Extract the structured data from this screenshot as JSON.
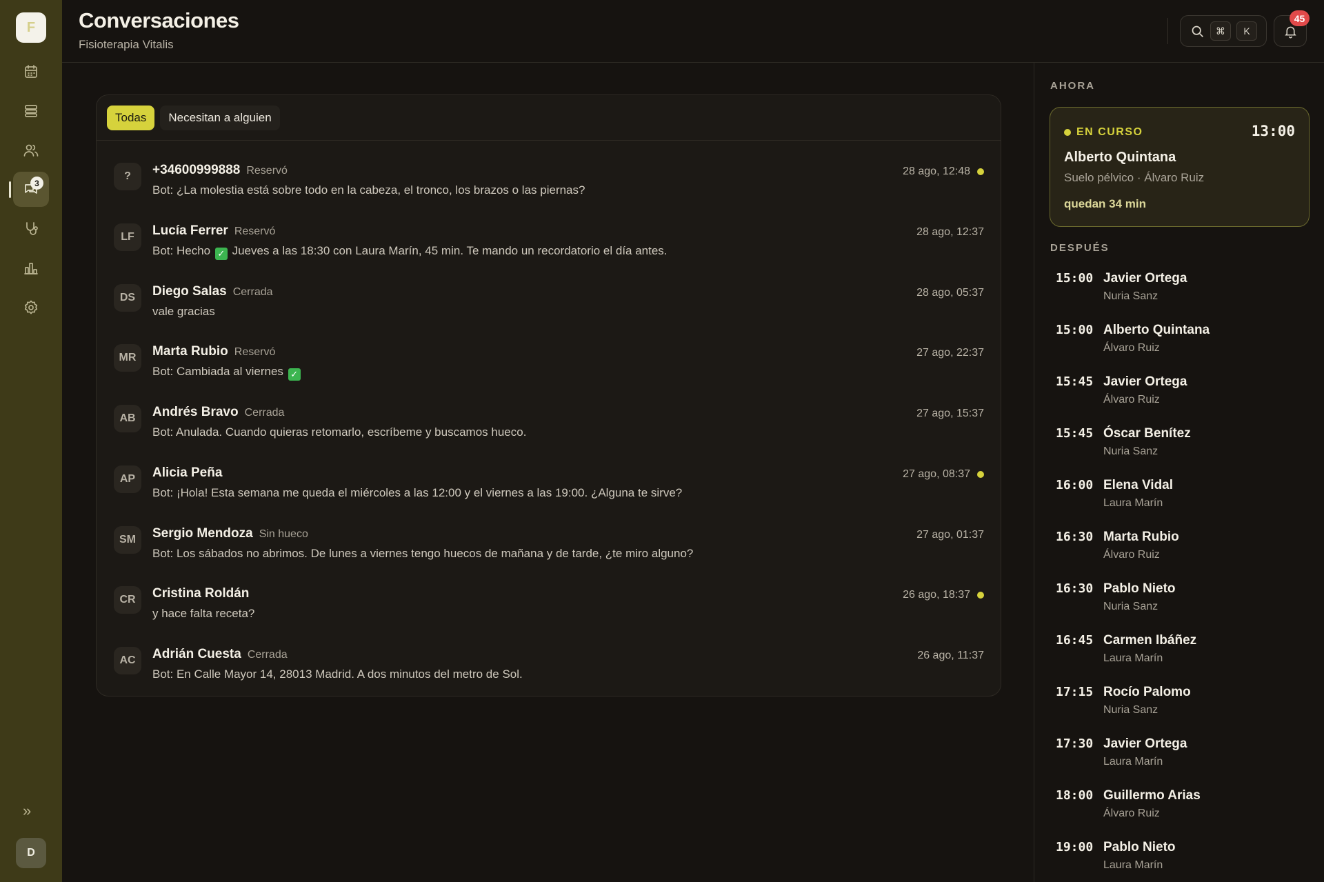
{
  "sidebar": {
    "logo_letter": "F",
    "nav": [
      {
        "name": "calendar-icon",
        "badge": null
      },
      {
        "name": "stack-icon",
        "badge": null
      },
      {
        "name": "users-icon",
        "badge": null
      },
      {
        "name": "chat-icon",
        "badge": "3",
        "active": true
      },
      {
        "name": "stethoscope-icon",
        "badge": null
      },
      {
        "name": "bar-chart-icon",
        "badge": null
      },
      {
        "name": "gear-icon",
        "badge": null
      }
    ],
    "expand_glyph": "»",
    "user_initial": "D"
  },
  "header": {
    "title": "Conversaciones",
    "subtitle": "Fisioterapia Vitalis",
    "shortcut_keys": [
      "⌘",
      "K"
    ],
    "notification_count": "45"
  },
  "tabs": [
    {
      "label": "Todas",
      "active": true
    },
    {
      "label": "Necesitan a alguien",
      "active": false
    }
  ],
  "conversations": [
    {
      "initials": "?",
      "name": "+34600999888",
      "status": "Reservó",
      "time": "28 ago, 12:48",
      "unread": true,
      "message": "Bot: ¿La molestia está sobre todo en la cabeza, el tronco, los brazos o las piernas?"
    },
    {
      "initials": "LF",
      "name": "Lucía Ferrer",
      "status": "Reservó",
      "time": "28 ago, 12:37",
      "unread": false,
      "message_before": "Bot: Hecho",
      "message_after": "Jueves a las 18:30 con Laura Marín, 45 min. Te mando un recordatorio el día antes."
    },
    {
      "initials": "DS",
      "name": "Diego Salas",
      "status": "Cerrada",
      "time": "28 ago, 05:37",
      "unread": false,
      "message": "vale gracias"
    },
    {
      "initials": "MR",
      "name": "Marta Rubio",
      "status": "Reservó",
      "time": "27 ago, 22:37",
      "unread": false,
      "message_before": "Bot: Cambiada al viernes",
      "message_after": ""
    },
    {
      "initials": "AB",
      "name": "Andrés Bravo",
      "status": "Cerrada",
      "time": "27 ago, 15:37",
      "unread": false,
      "message": "Bot: Anulada. Cuando quieras retomarlo, escríbeme y buscamos hueco."
    },
    {
      "initials": "AP",
      "name": "Alicia Peña",
      "status": "",
      "time": "27 ago, 08:37",
      "unread": true,
      "message": "Bot: ¡Hola! Esta semana me queda el miércoles a las 12:00 y el viernes a las 19:00. ¿Alguna te sirve?"
    },
    {
      "initials": "SM",
      "name": "Sergio Mendoza",
      "status": "Sin hueco",
      "time": "27 ago, 01:37",
      "unread": false,
      "message": "Bot: Los sábados no abrimos. De lunes a viernes tengo huecos de mañana y de tarde, ¿te miro alguno?"
    },
    {
      "initials": "CR",
      "name": "Cristina Roldán",
      "status": "",
      "time": "26 ago, 18:37",
      "unread": true,
      "message": "y hace falta receta?"
    },
    {
      "initials": "AC",
      "name": "Adrián Cuesta",
      "status": "Cerrada",
      "time": "26 ago, 11:37",
      "unread": false,
      "message": "Bot: En Calle Mayor 14, 28013 Madrid. A dos minutos del metro de Sol."
    }
  ],
  "now": {
    "section_label": "AHORA",
    "status": "EN CURSO",
    "time": "13:00",
    "patient": "Alberto Quintana",
    "detail": "Suelo pélvico · Álvaro Ruiz",
    "remaining": "quedan 34 min"
  },
  "later": {
    "section_label": "DESPUÉS",
    "items": [
      {
        "time": "15:00",
        "patient": "Javier Ortega",
        "therapist": "Nuria Sanz"
      },
      {
        "time": "15:00",
        "patient": "Alberto Quintana",
        "therapist": "Álvaro Ruiz"
      },
      {
        "time": "15:45",
        "patient": "Javier Ortega",
        "therapist": "Álvaro Ruiz"
      },
      {
        "time": "15:45",
        "patient": "Óscar Benítez",
        "therapist": "Nuria Sanz"
      },
      {
        "time": "16:00",
        "patient": "Elena Vidal",
        "therapist": "Laura Marín"
      },
      {
        "time": "16:30",
        "patient": "Marta Rubio",
        "therapist": "Álvaro Ruiz"
      },
      {
        "time": "16:30",
        "patient": "Pablo Nieto",
        "therapist": "Nuria Sanz"
      },
      {
        "time": "16:45",
        "patient": "Carmen Ibáñez",
        "therapist": "Laura Marín"
      },
      {
        "time": "17:15",
        "patient": "Rocío Palomo",
        "therapist": "Nuria Sanz"
      },
      {
        "time": "17:30",
        "patient": "Javier Ortega",
        "therapist": "Laura Marín"
      },
      {
        "time": "18:00",
        "patient": "Guillermo Arias",
        "therapist": "Álvaro Ruiz"
      },
      {
        "time": "19:00",
        "patient": "Pablo Nieto",
        "therapist": "Laura Marín"
      }
    ]
  },
  "colors": {
    "accent": "#d6d23c",
    "sidebar": "#3e3a18",
    "background": "#161310",
    "badge_red": "#e14a4a"
  }
}
